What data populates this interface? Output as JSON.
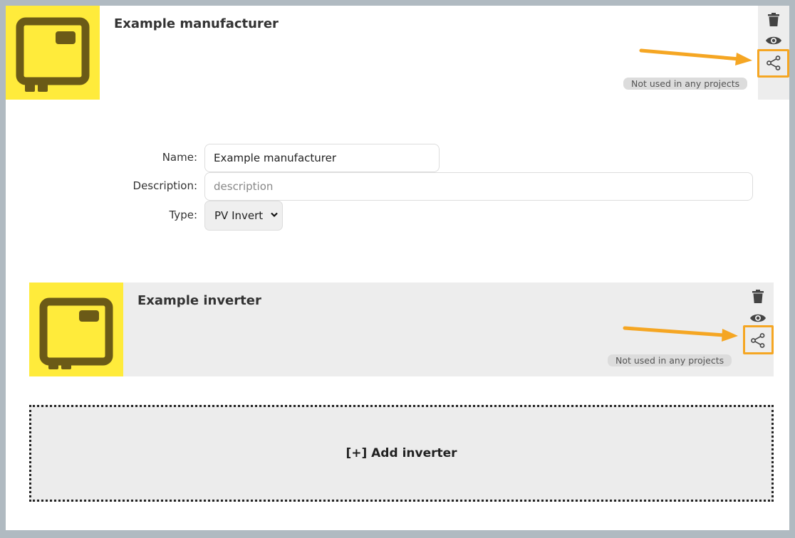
{
  "manufacturer": {
    "title": "Example manufacturer",
    "usage_badge": "Not used in any projects",
    "thumbnail_icon": "inverter-box-icon",
    "actions": [
      "trash-icon",
      "eye-icon",
      "share-icon"
    ]
  },
  "form": {
    "name_label": "Name:",
    "name_value": "Example manufacturer",
    "description_label": "Description:",
    "description_value": "",
    "description_placeholder": "description",
    "type_label": "Type:",
    "type_selected": "PV Invert"
  },
  "inverter": {
    "title": "Example inverter",
    "usage_badge": "Not used in any projects",
    "thumbnail_icon": "inverter-box-icon",
    "actions": [
      "trash-icon",
      "eye-icon",
      "share-icon"
    ]
  },
  "add_inverter_label": "[+] Add inverter",
  "colors": {
    "thumbnail_bg": "#ffeb3b",
    "thumbnail_icon": "#6b5a17",
    "highlight": "#f5a623",
    "card_bg": "#ededed"
  }
}
